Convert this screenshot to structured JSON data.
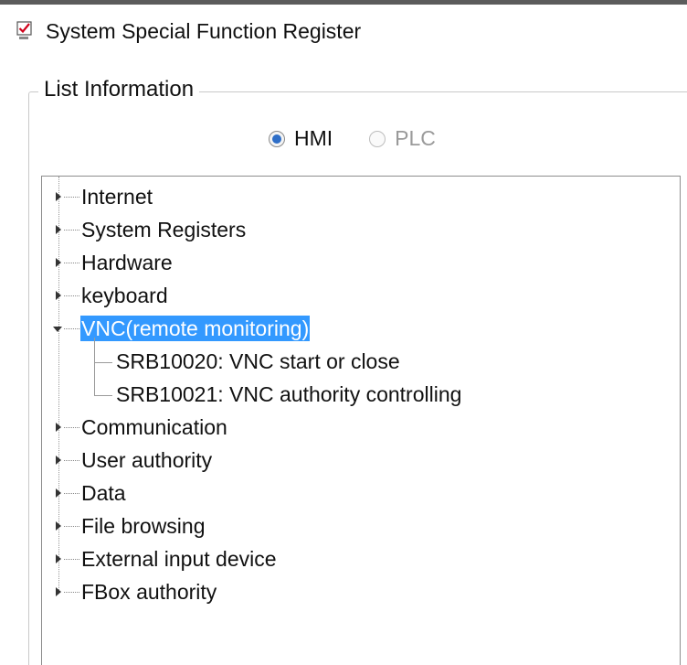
{
  "window": {
    "title": "System Special Function Register"
  },
  "group": {
    "label": "List Information"
  },
  "radios": [
    {
      "label": "HMI",
      "checked": true,
      "enabled": true
    },
    {
      "label": "PLC",
      "checked": false,
      "enabled": false
    }
  ],
  "tree": {
    "items": [
      {
        "label": "Internet",
        "expanded": false
      },
      {
        "label": "System Registers",
        "expanded": false
      },
      {
        "label": "Hardware",
        "expanded": false
      },
      {
        "label": "keyboard",
        "expanded": false
      },
      {
        "label": "VNC(remote monitoring)",
        "expanded": true,
        "selected": true,
        "children": [
          {
            "label": "SRB10020:  VNC start or close"
          },
          {
            "label": "SRB10021:  VNC authority controlling"
          }
        ]
      },
      {
        "label": "Communication",
        "expanded": false
      },
      {
        "label": "User authority",
        "expanded": false
      },
      {
        "label": "Data",
        "expanded": false
      },
      {
        "label": "File browsing",
        "expanded": false
      },
      {
        "label": "External input device",
        "expanded": false
      },
      {
        "label": "FBox authority",
        "expanded": false
      }
    ]
  },
  "colors": {
    "selection": "#3399ff",
    "radio_checked": "#2e6ec7",
    "icon_red": "#d0021b"
  },
  "icons": {
    "title": "checkbox-register-icon"
  }
}
